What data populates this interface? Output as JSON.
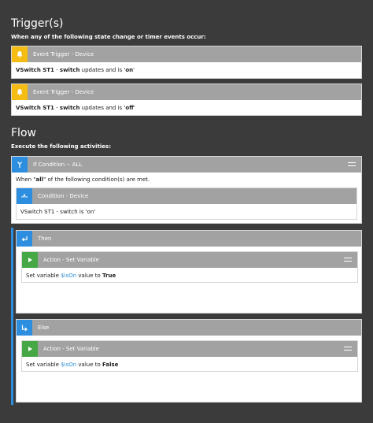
{
  "triggers": {
    "title": "Trigger(s)",
    "subtitle": "When any of the following state change or timer events occur:",
    "items": [
      {
        "header": "Event Trigger - Device",
        "icon": "bell-icon",
        "device": "VSwitch ST1",
        "dash": " - ",
        "attribute": "switch",
        "middle": " updates and is '",
        "value": "on",
        "end": "'"
      },
      {
        "header": "Event Trigger - Device",
        "icon": "bell-icon",
        "device": "VSwitch ST1",
        "dash": " - ",
        "attribute": "switch",
        "middle": " updates and is '",
        "value": "off",
        "end": "'"
      }
    ]
  },
  "flow": {
    "title": "Flow",
    "subtitle": "Execute the following activities:",
    "if": {
      "header": "If Condition -- ALL",
      "icon": "merge-icon",
      "desc_pre": "When \"",
      "desc_bold": "all",
      "desc_post": "\" of the following condition(s) are met.",
      "condition": {
        "header": "Condition - Device",
        "icon": "condition-icon",
        "text": "VSwitch ST1 - switch is 'on'"
      }
    },
    "then": {
      "header": "Then",
      "icon": "return-arrow-icon",
      "action": {
        "header": "Action - Set Variable",
        "icon": "play-icon",
        "pre": "Set variable ",
        "var": "$isOn",
        "mid": " value to ",
        "val": "True"
      }
    },
    "else": {
      "header": "Else",
      "icon": "corner-arrow-icon",
      "action": {
        "header": "Action - Set Variable",
        "icon": "play-icon",
        "pre": "Set variable ",
        "var": "$isOn",
        "mid": " value to ",
        "val": "False"
      }
    }
  },
  "colors": {
    "background": "#3b3b3b",
    "header_gray": "#a2a2a2",
    "trigger_yellow": "#f5bc14",
    "flow_blue": "#2d8ee0",
    "action_green": "#45a845",
    "variable_blue": "#2a8fd8"
  }
}
